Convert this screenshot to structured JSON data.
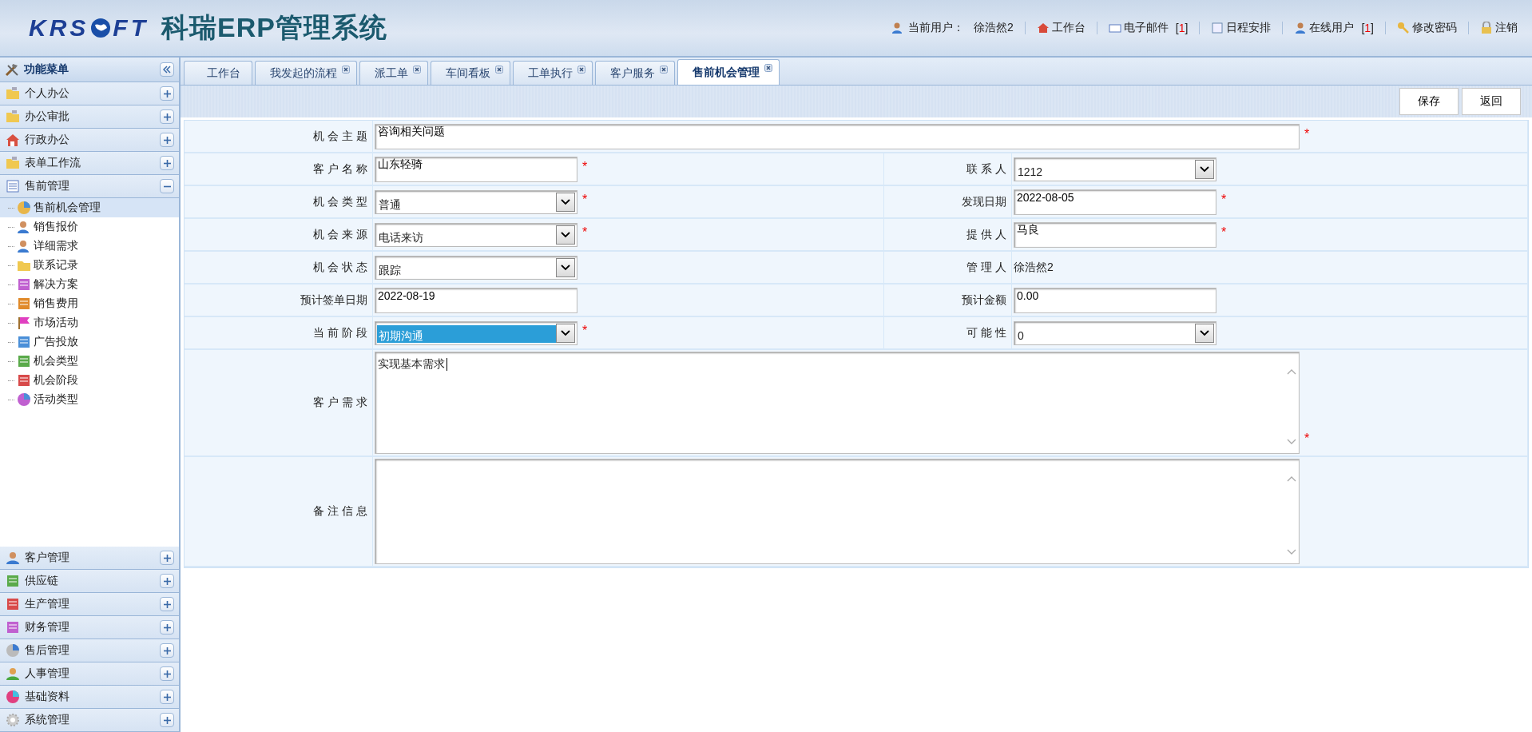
{
  "header": {
    "logo": {
      "left": "KRS",
      "right": "FT",
      "title": "科瑞ERP管理系统"
    },
    "user_label": "当前用户：",
    "user_name": "徐浩然2",
    "links": [
      {
        "label": "工作台"
      },
      {
        "label": "电子邮件",
        "count": [
          "[",
          "1",
          "]"
        ]
      },
      {
        "label": "日程安排"
      },
      {
        "label": "在线用户",
        "count": [
          "[",
          "1",
          "]"
        ]
      },
      {
        "label": "修改密码"
      },
      {
        "label": "注销"
      }
    ]
  },
  "sidebar": {
    "title": "功能菜单",
    "top_sections": [
      {
        "label": "个人办公",
        "expanded": false
      },
      {
        "label": "办公审批",
        "expanded": false
      },
      {
        "label": "行政办公",
        "expanded": false
      },
      {
        "label": "表单工作流",
        "expanded": false
      },
      {
        "label": "售前管理",
        "expanded": true,
        "children": [
          {
            "label": "售前机会管理",
            "selected": true
          },
          {
            "label": "销售报价",
            "selected": false
          },
          {
            "label": "详细需求",
            "selected": false
          },
          {
            "label": "联系记录",
            "selected": false
          },
          {
            "label": "解决方案",
            "selected": false
          },
          {
            "label": "销售费用",
            "selected": false
          },
          {
            "label": "市场活动",
            "selected": false
          },
          {
            "label": "广告投放",
            "selected": false
          },
          {
            "label": "机会类型",
            "selected": false
          },
          {
            "label": "机会阶段",
            "selected": false
          },
          {
            "label": "活动类型",
            "selected": false
          }
        ]
      }
    ],
    "bottom_sections": [
      {
        "label": "客户管理",
        "expanded": false
      },
      {
        "label": "供应链",
        "expanded": false
      },
      {
        "label": "生产管理",
        "expanded": false
      },
      {
        "label": "财务管理",
        "expanded": false
      },
      {
        "label": "售后管理",
        "expanded": false
      },
      {
        "label": "人事管理",
        "expanded": false
      },
      {
        "label": "基础资料",
        "expanded": false
      },
      {
        "label": "系统管理",
        "expanded": false
      }
    ]
  },
  "tabs": [
    {
      "label": "工作台",
      "closable": false,
      "selected": false
    },
    {
      "label": "我发起的流程",
      "closable": true,
      "selected": false
    },
    {
      "label": "派工单",
      "closable": true,
      "selected": false
    },
    {
      "label": "车间看板",
      "closable": true,
      "selected": false
    },
    {
      "label": "工单执行",
      "closable": true,
      "selected": false
    },
    {
      "label": "客户服务",
      "closable": true,
      "selected": false
    },
    {
      "label": "售前机会管理",
      "closable": true,
      "selected": true
    }
  ],
  "toolbar": {
    "buttons": [
      "保存",
      "返回"
    ]
  },
  "form": {
    "rows": [
      {
        "kind": "wide",
        "fields": [
          {
            "label": "机 会 主 题",
            "kind": "text",
            "value": "咨询相关问题",
            "mark": "*"
          }
        ]
      },
      {
        "kind": "pair",
        "fields": [
          {
            "label": "客 户 名 称",
            "kind": "text",
            "value": "山东轻骑",
            "mark": "*"
          },
          {
            "label": "联 系 人",
            "kind": "select",
            "value": "1212"
          }
        ]
      },
      {
        "kind": "pair",
        "fields": [
          {
            "label": "机 会 类 型",
            "kind": "select",
            "value": "普通",
            "mark": "*"
          },
          {
            "label": "发现日期",
            "kind": "text",
            "value": "2022-08-05",
            "mark": "*"
          }
        ]
      },
      {
        "kind": "pair",
        "fields": [
          {
            "label": "机 会 来 源",
            "kind": "select",
            "value": "电话来访",
            "mark": "*"
          },
          {
            "label": "提 供 人",
            "kind": "text",
            "value": "马良",
            "mark": "*"
          }
        ]
      },
      {
        "kind": "pair",
        "fields": [
          {
            "label": "机 会 状 态",
            "kind": "select",
            "value": "跟踪"
          },
          {
            "label": "管 理 人",
            "kind": "static",
            "value": "徐浩然2"
          }
        ]
      },
      {
        "kind": "pair",
        "fields": [
          {
            "label": "预计签单日期",
            "kind": "text",
            "value": "2022-08-19"
          },
          {
            "label": "预计金额",
            "kind": "text",
            "value": "0.00"
          }
        ]
      },
      {
        "kind": "pair",
        "fields": [
          {
            "label": "当 前 阶 段",
            "kind": "select",
            "value": "初期沟通",
            "mark": "*",
            "highlighted": true
          },
          {
            "label": "可 能 性",
            "kind": "select",
            "value": "0",
            "highlighted": false
          }
        ]
      },
      {
        "kind": "area",
        "fields": [
          {
            "label": "客 户 需 求",
            "kind": "textarea",
            "value": "实现基本需求",
            "mark": "*",
            "focused": true
          }
        ]
      },
      {
        "kind": "area",
        "fields": [
          {
            "label": "备 注 信 息",
            "kind": "textarea",
            "focused": false
          }
        ]
      }
    ]
  }
}
